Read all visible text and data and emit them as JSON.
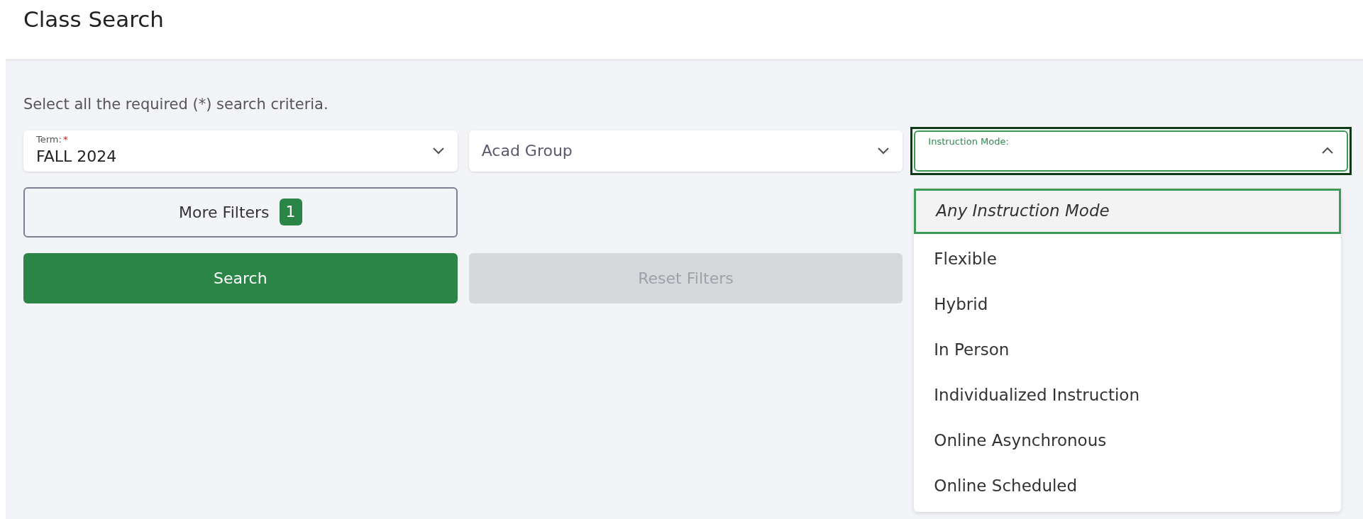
{
  "page_title": "Class Search",
  "instructions": "Select all the required (*) search criteria.",
  "fields": [
    {
      "kind": "filled",
      "label": "Term:",
      "required_mark": "*",
      "value": "FALL 2024",
      "expanded": false
    },
    {
      "kind": "empty",
      "placeholder": "Acad Group",
      "expanded": false
    },
    {
      "kind": "filled",
      "label": "Instruction Mode:",
      "expanded": true,
      "options": [
        {
          "label": "Any Instruction Mode",
          "kind": "any",
          "selected": true
        },
        {
          "label": "Flexible",
          "kind": "option",
          "selected": false
        },
        {
          "label": "Hybrid",
          "kind": "option",
          "selected": false
        },
        {
          "label": "In Person",
          "kind": "option",
          "selected": false
        },
        {
          "label": "Individualized Instruction",
          "kind": "option",
          "selected": false
        },
        {
          "label": "Online Asynchronous",
          "kind": "option",
          "selected": false
        },
        {
          "label": "Online Scheduled",
          "kind": "option",
          "selected": false
        }
      ]
    }
  ],
  "more_filters": {
    "label": "More Filters",
    "count": "1"
  },
  "buttons": [
    {
      "label": "Search",
      "disabled": false
    },
    {
      "label": "Reset Filters",
      "disabled": true
    }
  ]
}
